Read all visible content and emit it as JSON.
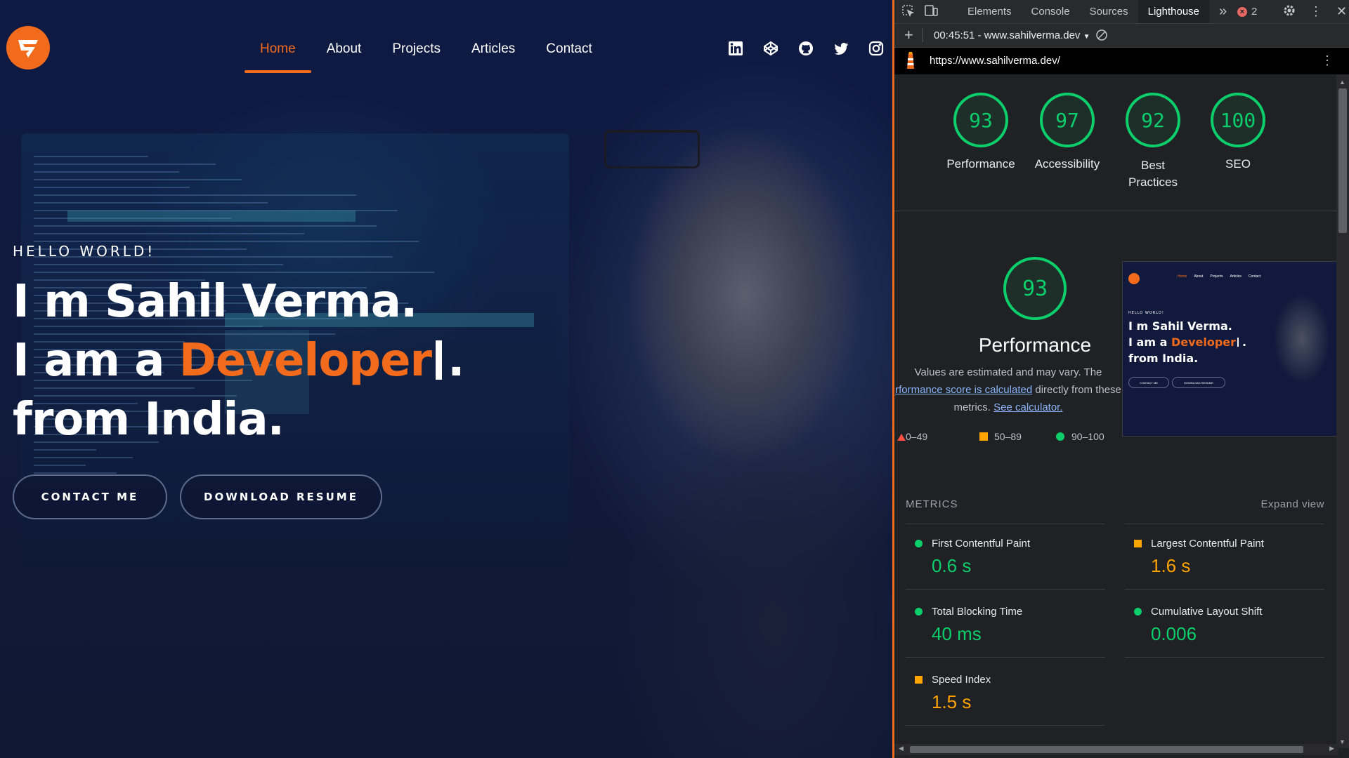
{
  "site": {
    "nav": [
      "Home",
      "About",
      "Projects",
      "Articles",
      "Contact"
    ],
    "hello": "HELLO WORLD!",
    "line1": "I m Sahil Verma.",
    "line2_prefix": "I am a ",
    "line2_accent": "Developer",
    "line2_suffix": ".",
    "line3": "from India.",
    "contact_button": "CONTACT ME",
    "resume_button": "DOWNLOAD RESUME",
    "social_icons": [
      "linkedin-icon",
      "codepen-icon",
      "github-icon",
      "twitter-icon",
      "instagram-icon"
    ],
    "accent_color": "#f26b1d"
  },
  "devtools": {
    "tabs": [
      "Elements",
      "Console",
      "Sources",
      "Lighthouse"
    ],
    "active_tab": "Lighthouse",
    "error_count": "2",
    "report_select": "00:45:51 - www.sahilverma.dev",
    "url": "https://www.sahilverma.dev/",
    "scores": [
      {
        "score": "93",
        "label": "Performance"
      },
      {
        "score": "97",
        "label": "Accessibility"
      },
      {
        "score": "92",
        "label": "Best Practices"
      },
      {
        "score": "100",
        "label": "SEO"
      }
    ],
    "perf": {
      "score": "93",
      "title": "Performance",
      "desc_line1": "Values are estimated and may vary. The",
      "desc_link": "rformance score is calculated",
      "desc_mid": " directly from these",
      "desc_line3": "metrics. ",
      "desc_link2": "See calculator.",
      "legend": [
        "0–49",
        "50–89",
        "90–100"
      ]
    },
    "metrics_title": "METRICS",
    "expand": "Expand view",
    "metrics": [
      {
        "label": "First Contentful Paint",
        "value": "0.6 s",
        "status": "green"
      },
      {
        "label": "Largest Contentful Paint",
        "value": "1.6 s",
        "status": "orange"
      },
      {
        "label": "Total Blocking Time",
        "value": "40 ms",
        "status": "green"
      },
      {
        "label": "Cumulative Layout Shift",
        "value": "0.006",
        "status": "green"
      },
      {
        "label": "Speed Index",
        "value": "1.5 s",
        "status": "orange"
      }
    ],
    "thumb": {
      "hello": "HELLO WORLD!",
      "line1": "I m Sahil Verma.",
      "line2_prefix": "I am a ",
      "line2_accent": "Developer",
      "line2_suffix": ".",
      "line3": "from India.",
      "nav": [
        "Home",
        "About",
        "Projects",
        "Articles",
        "Contact"
      ],
      "btn1": "CONTACT ME",
      "btn2": "DOWNLOAD RESUME"
    },
    "status_colors": {
      "pass": "#0cce6b",
      "average": "#ffa400",
      "fail": "#ff4e42"
    }
  }
}
